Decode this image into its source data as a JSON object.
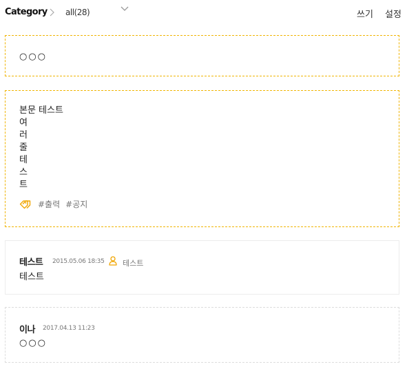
{
  "header": {
    "category_label": "Category",
    "breadcrumb_separator_icon": "chevron-right-icon",
    "filter_value": "all(28)",
    "dropdown_icon": "chevron-down-icon",
    "write_label": "쓰기",
    "settings_label": "설정"
  },
  "notice": {
    "text": "○○○"
  },
  "post": {
    "lines": [
      "본문 테스트",
      "여",
      "러",
      "줄",
      "테",
      "스",
      "트"
    ],
    "tag_icon": "tag-icon",
    "tags": [
      "#출력",
      "#공지"
    ]
  },
  "comments": [
    {
      "name": "테스트",
      "date": "2015.05.06 18:35",
      "user_icon": "user-icon",
      "user": "테스트",
      "body": "테스트"
    },
    {
      "name": "이나",
      "date": "2017.04.13 11:23",
      "body": "○○○"
    }
  ],
  "colors": {
    "accent": "#f0a500",
    "dashed_border": "#f0b400",
    "comment_border": "#ececec"
  }
}
